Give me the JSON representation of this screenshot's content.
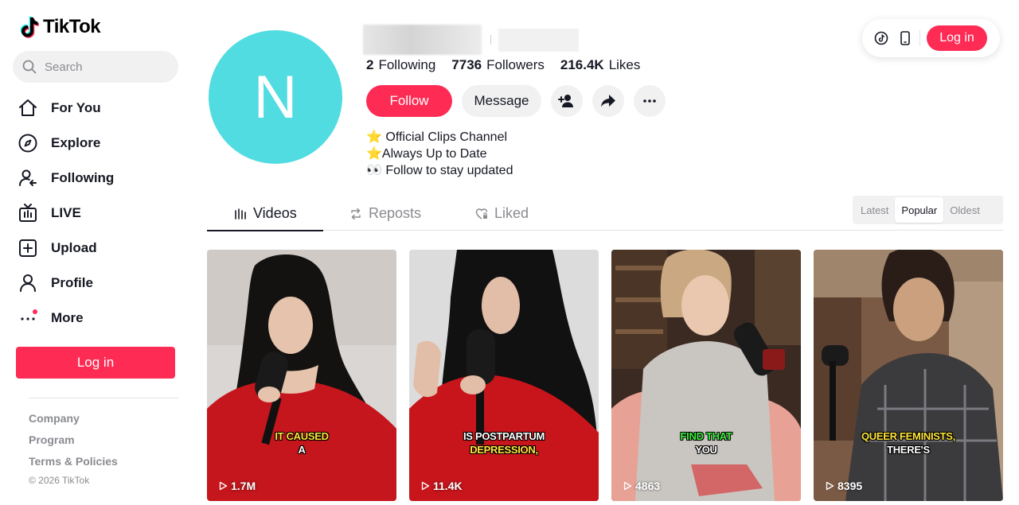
{
  "app": {
    "logo_text": "TikTok",
    "brand_color": "#fe2c55",
    "search_placeholder": "Search"
  },
  "sidebar": {
    "items": [
      {
        "label": "For You",
        "icon": "home-icon"
      },
      {
        "label": "Explore",
        "icon": "compass-icon"
      },
      {
        "label": "Following",
        "icon": "following-icon"
      },
      {
        "label": "LIVE",
        "icon": "live-icon"
      },
      {
        "label": "Upload",
        "icon": "upload-icon"
      },
      {
        "label": "Profile",
        "icon": "profile-icon"
      },
      {
        "label": "More",
        "icon": "more-icon"
      }
    ],
    "login_label": "Log in",
    "footer": [
      "Company",
      "Program",
      "Terms & Policies"
    ],
    "copyright": "© 2026 TikTok"
  },
  "profile": {
    "avatar_letter": "N",
    "avatar_color": "#50dce1",
    "following_count": "2",
    "following_label": "Following",
    "followers_count": "7736",
    "followers_label": "Followers",
    "likes_count": "216.4K",
    "likes_label": "Likes",
    "follow_label": "Follow",
    "message_label": "Message",
    "bio": [
      "⭐ Official Clips Channel",
      "⭐Always Up to Date",
      "👀 Follow to stay updated"
    ]
  },
  "header_right": {
    "login_label": "Log in"
  },
  "tabs": {
    "items": [
      "Videos",
      "Reposts",
      "Liked"
    ],
    "active": "Videos",
    "sort": [
      "Latest",
      "Popular",
      "Oldest"
    ],
    "sort_active": "Popular"
  },
  "videos": [
    {
      "caption_line1": "IT CAUSED",
      "caption_line2": "A",
      "views": "1.7M"
    },
    {
      "caption_line1": "IS POSTPARTUM",
      "caption_line2": "DEPRESSION,",
      "views": "11.4K"
    },
    {
      "caption_line1": "FIND THAT",
      "caption_line2": "YOU",
      "views": "4863"
    },
    {
      "caption_line1": "QUEER FEMINISTS,",
      "caption_line2": "THERE'S",
      "views": "8395"
    }
  ]
}
